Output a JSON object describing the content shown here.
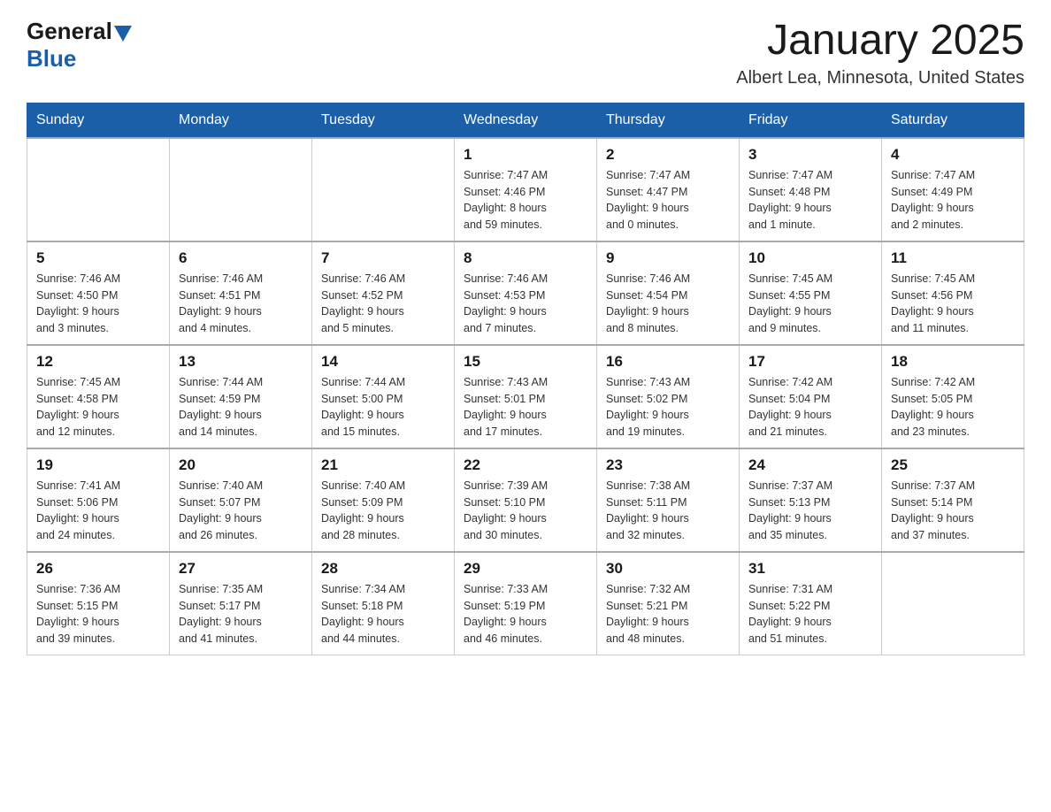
{
  "header": {
    "logo_general": "General",
    "logo_blue": "Blue",
    "month_title": "January 2025",
    "subtitle": "Albert Lea, Minnesota, United States"
  },
  "days_of_week": [
    "Sunday",
    "Monday",
    "Tuesday",
    "Wednesday",
    "Thursday",
    "Friday",
    "Saturday"
  ],
  "weeks": [
    [
      {
        "day": "",
        "info": ""
      },
      {
        "day": "",
        "info": ""
      },
      {
        "day": "",
        "info": ""
      },
      {
        "day": "1",
        "info": "Sunrise: 7:47 AM\nSunset: 4:46 PM\nDaylight: 8 hours\nand 59 minutes."
      },
      {
        "day": "2",
        "info": "Sunrise: 7:47 AM\nSunset: 4:47 PM\nDaylight: 9 hours\nand 0 minutes."
      },
      {
        "day": "3",
        "info": "Sunrise: 7:47 AM\nSunset: 4:48 PM\nDaylight: 9 hours\nand 1 minute."
      },
      {
        "day": "4",
        "info": "Sunrise: 7:47 AM\nSunset: 4:49 PM\nDaylight: 9 hours\nand 2 minutes."
      }
    ],
    [
      {
        "day": "5",
        "info": "Sunrise: 7:46 AM\nSunset: 4:50 PM\nDaylight: 9 hours\nand 3 minutes."
      },
      {
        "day": "6",
        "info": "Sunrise: 7:46 AM\nSunset: 4:51 PM\nDaylight: 9 hours\nand 4 minutes."
      },
      {
        "day": "7",
        "info": "Sunrise: 7:46 AM\nSunset: 4:52 PM\nDaylight: 9 hours\nand 5 minutes."
      },
      {
        "day": "8",
        "info": "Sunrise: 7:46 AM\nSunset: 4:53 PM\nDaylight: 9 hours\nand 7 minutes."
      },
      {
        "day": "9",
        "info": "Sunrise: 7:46 AM\nSunset: 4:54 PM\nDaylight: 9 hours\nand 8 minutes."
      },
      {
        "day": "10",
        "info": "Sunrise: 7:45 AM\nSunset: 4:55 PM\nDaylight: 9 hours\nand 9 minutes."
      },
      {
        "day": "11",
        "info": "Sunrise: 7:45 AM\nSunset: 4:56 PM\nDaylight: 9 hours\nand 11 minutes."
      }
    ],
    [
      {
        "day": "12",
        "info": "Sunrise: 7:45 AM\nSunset: 4:58 PM\nDaylight: 9 hours\nand 12 minutes."
      },
      {
        "day": "13",
        "info": "Sunrise: 7:44 AM\nSunset: 4:59 PM\nDaylight: 9 hours\nand 14 minutes."
      },
      {
        "day": "14",
        "info": "Sunrise: 7:44 AM\nSunset: 5:00 PM\nDaylight: 9 hours\nand 15 minutes."
      },
      {
        "day": "15",
        "info": "Sunrise: 7:43 AM\nSunset: 5:01 PM\nDaylight: 9 hours\nand 17 minutes."
      },
      {
        "day": "16",
        "info": "Sunrise: 7:43 AM\nSunset: 5:02 PM\nDaylight: 9 hours\nand 19 minutes."
      },
      {
        "day": "17",
        "info": "Sunrise: 7:42 AM\nSunset: 5:04 PM\nDaylight: 9 hours\nand 21 minutes."
      },
      {
        "day": "18",
        "info": "Sunrise: 7:42 AM\nSunset: 5:05 PM\nDaylight: 9 hours\nand 23 minutes."
      }
    ],
    [
      {
        "day": "19",
        "info": "Sunrise: 7:41 AM\nSunset: 5:06 PM\nDaylight: 9 hours\nand 24 minutes."
      },
      {
        "day": "20",
        "info": "Sunrise: 7:40 AM\nSunset: 5:07 PM\nDaylight: 9 hours\nand 26 minutes."
      },
      {
        "day": "21",
        "info": "Sunrise: 7:40 AM\nSunset: 5:09 PM\nDaylight: 9 hours\nand 28 minutes."
      },
      {
        "day": "22",
        "info": "Sunrise: 7:39 AM\nSunset: 5:10 PM\nDaylight: 9 hours\nand 30 minutes."
      },
      {
        "day": "23",
        "info": "Sunrise: 7:38 AM\nSunset: 5:11 PM\nDaylight: 9 hours\nand 32 minutes."
      },
      {
        "day": "24",
        "info": "Sunrise: 7:37 AM\nSunset: 5:13 PM\nDaylight: 9 hours\nand 35 minutes."
      },
      {
        "day": "25",
        "info": "Sunrise: 7:37 AM\nSunset: 5:14 PM\nDaylight: 9 hours\nand 37 minutes."
      }
    ],
    [
      {
        "day": "26",
        "info": "Sunrise: 7:36 AM\nSunset: 5:15 PM\nDaylight: 9 hours\nand 39 minutes."
      },
      {
        "day": "27",
        "info": "Sunrise: 7:35 AM\nSunset: 5:17 PM\nDaylight: 9 hours\nand 41 minutes."
      },
      {
        "day": "28",
        "info": "Sunrise: 7:34 AM\nSunset: 5:18 PM\nDaylight: 9 hours\nand 44 minutes."
      },
      {
        "day": "29",
        "info": "Sunrise: 7:33 AM\nSunset: 5:19 PM\nDaylight: 9 hours\nand 46 minutes."
      },
      {
        "day": "30",
        "info": "Sunrise: 7:32 AM\nSunset: 5:21 PM\nDaylight: 9 hours\nand 48 minutes."
      },
      {
        "day": "31",
        "info": "Sunrise: 7:31 AM\nSunset: 5:22 PM\nDaylight: 9 hours\nand 51 minutes."
      },
      {
        "day": "",
        "info": ""
      }
    ]
  ]
}
